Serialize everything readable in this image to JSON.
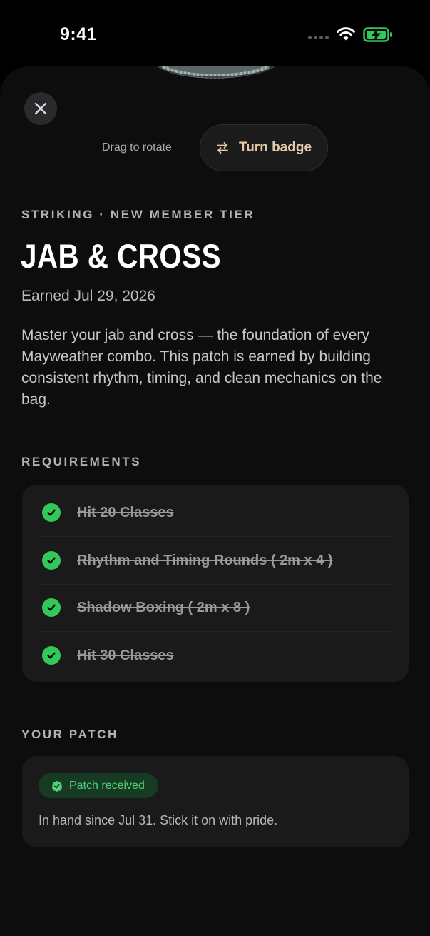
{
  "status_bar": {
    "time": "9:41",
    "battery_color": "#34c759"
  },
  "controls": {
    "close_icon": "close-icon",
    "drag_hint": "Drag to rotate",
    "turn_badge_label": "Turn badge",
    "turn_icon": "swap-arrows-icon",
    "accent_color": "#e6c9a7"
  },
  "badge": {
    "eyebrow": "STRIKING · NEW MEMBER TIER",
    "title": "JAB & CROSS",
    "earned": "Earned Jul 29, 2026",
    "description": "Master your jab and cross — the foundation of every Mayweather combo. This patch is earned by building consistent rhythm, timing, and clean mechanics on the bag."
  },
  "requirements": {
    "label": "REQUIREMENTS",
    "items": [
      {
        "label": "Hit 20 Classes",
        "done": true
      },
      {
        "label": "Rhythm and Timing Rounds ( 2m x 4 )",
        "done": true
      },
      {
        "label": "Shadow Boxing ( 2m x 8 )",
        "done": true
      },
      {
        "label": "Hit 30 Classes",
        "done": true
      }
    ],
    "check_color": "#34c759"
  },
  "patch": {
    "label": "YOUR PATCH",
    "status": "Patch received",
    "status_icon": "verified-check-icon",
    "note": "In hand since Jul 31. Stick it on with pride.",
    "status_color": "#4fd17a"
  }
}
